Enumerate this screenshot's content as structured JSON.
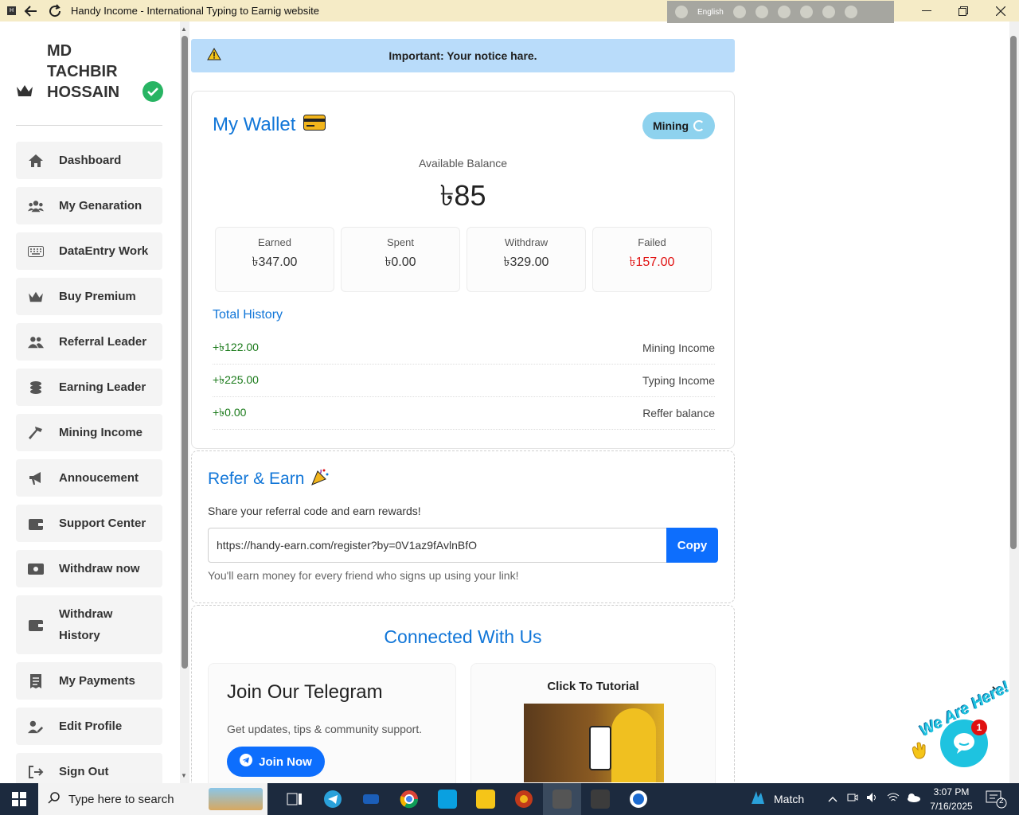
{
  "window": {
    "title": "Handy Income - International Typing to Earnig website",
    "language": "English"
  },
  "profile": {
    "name": "MD TACHBIR HOSSAIN"
  },
  "sidebar": {
    "items": [
      {
        "label": "Dashboard",
        "icon": "home-icon"
      },
      {
        "label": "My Genaration",
        "icon": "users-icon"
      },
      {
        "label": "DataEntry Work",
        "icon": "keyboard-icon"
      },
      {
        "label": "Buy Premium",
        "icon": "crown-icon"
      },
      {
        "label": "Referral Leader",
        "icon": "user-group-icon"
      },
      {
        "label": "Earning Leader",
        "icon": "coins-icon"
      },
      {
        "label": "Mining Income",
        "icon": "hammer-icon"
      },
      {
        "label": "Annoucement",
        "icon": "megaphone-icon"
      },
      {
        "label": "Support Center",
        "icon": "wallet-icon"
      },
      {
        "label": "Withdraw now",
        "icon": "money-icon"
      },
      {
        "label": "Withdraw History",
        "icon": "wallet-icon"
      },
      {
        "label": "My Payments",
        "icon": "receipt-icon"
      },
      {
        "label": "Edit Profile",
        "icon": "user-edit-icon"
      },
      {
        "label": "Sign Out",
        "icon": "sign-out-icon"
      }
    ]
  },
  "notice": {
    "text": "Important: Your notice hare."
  },
  "wallet": {
    "title": "My Wallet",
    "mining_label": "Mining",
    "available_label": "Available Balance",
    "available_value": "৳85",
    "stats": [
      {
        "label": "Earned",
        "value": "৳347.00"
      },
      {
        "label": "Spent",
        "value": "৳0.00"
      },
      {
        "label": "Withdraw",
        "value": "৳329.00"
      },
      {
        "label": "Failed",
        "value": "৳157.00"
      }
    ],
    "history_title": "Total History",
    "history": [
      {
        "amount": "+৳122.00",
        "source": "Mining Income"
      },
      {
        "amount": "+৳225.00",
        "source": "Typing Income"
      },
      {
        "amount": "+৳0.00",
        "source": "Reffer balance"
      }
    ]
  },
  "refer": {
    "title": "Refer & Earn",
    "subtitle": "Share your referral code and earn rewards!",
    "link": "https://handy-earn.com/register?by=0V1az9fAvlnBfO",
    "copy_label": "Copy",
    "note": "You'll earn money for every friend who signs up using your link!"
  },
  "connect": {
    "title": "Connected With Us",
    "telegram_title": "Join Our Telegram",
    "telegram_sub": "Get updates, tips & community support.",
    "join_label": "Join Now",
    "tutorial_title": "Click To Tutorial"
  },
  "chat": {
    "tagline": "We Are Here!",
    "badge": "1"
  },
  "taskbar": {
    "search_placeholder": "Type here to search",
    "weather": "Match",
    "time": "3:07 PM",
    "date": "7/16/2025",
    "notifications": "2"
  },
  "colors": {
    "accent": "#1176d8",
    "primary_button": "#0d6efd",
    "notice_bg": "#b9dcfa",
    "failed": "#e01010",
    "income": "#1a7a1a",
    "verified": "#28b463"
  }
}
